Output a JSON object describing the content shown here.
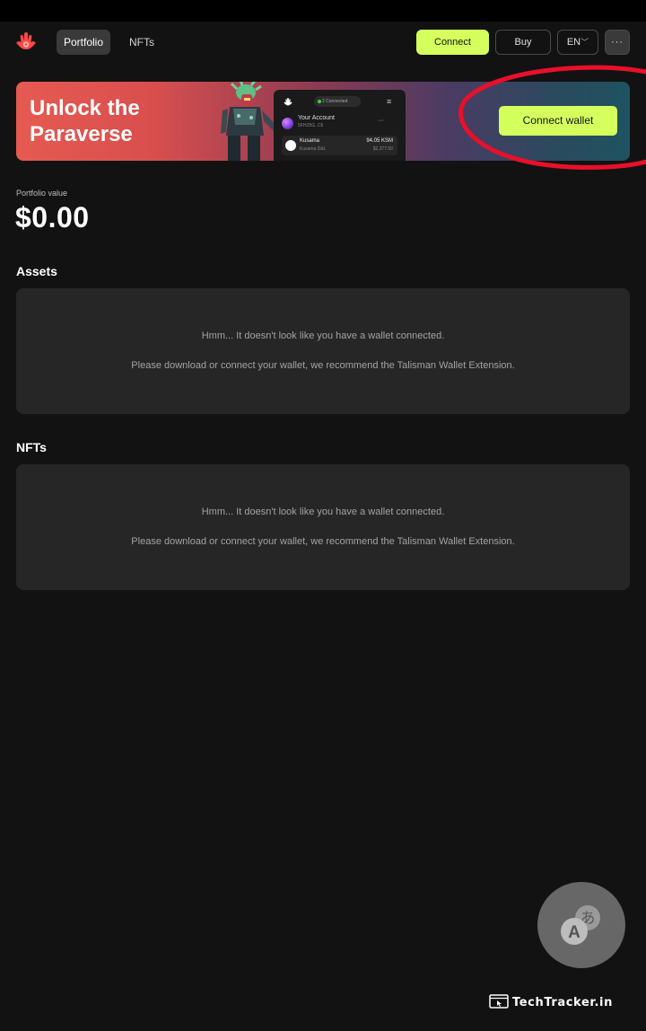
{
  "nav": {
    "tabs": [
      {
        "label": "Portfolio",
        "active": true
      },
      {
        "label": "NFTs",
        "active": false
      }
    ],
    "connect_label": "Connect",
    "buy_label": "Buy",
    "language_label": "EN",
    "more_label": "···"
  },
  "banner": {
    "title": "Unlock the Paraverse",
    "cta_label": "Connect wallet",
    "mock": {
      "status": "2 Connected",
      "account_name": "Your Account",
      "account_address": "5FHZ5G..C6",
      "account_more": "···",
      "token_name": "Kusama",
      "token_chain": "Kusama D&L",
      "token_amount": "94.05 KSM",
      "token_fiat": "$2,377.50"
    }
  },
  "portfolio": {
    "label": "Portfolio value",
    "value": "$0.00"
  },
  "sections": {
    "assets": {
      "title": "Assets",
      "line1": "Hmm... It doesn't look like you have a wallet connected.",
      "line2": "Please download or connect your wallet, we recommend the Talisman Wallet Extension."
    },
    "nfts": {
      "title": "NFTs",
      "line1": "Hmm... It doesn't look like you have a wallet connected.",
      "line2": "Please download or connect your wallet, we recommend the Talisman Wallet Extension."
    }
  },
  "watermark": "TechTracker.in",
  "colors": {
    "background": "#121212",
    "accent": "#d5ff5c",
    "panel": "#262626",
    "brand": "#fd4848",
    "annotation_ring": "#e8102a"
  },
  "icons": {
    "logo": "talisman-hand-icon",
    "translate": "translate-icon",
    "dropdown": "chevron-down-icon"
  }
}
